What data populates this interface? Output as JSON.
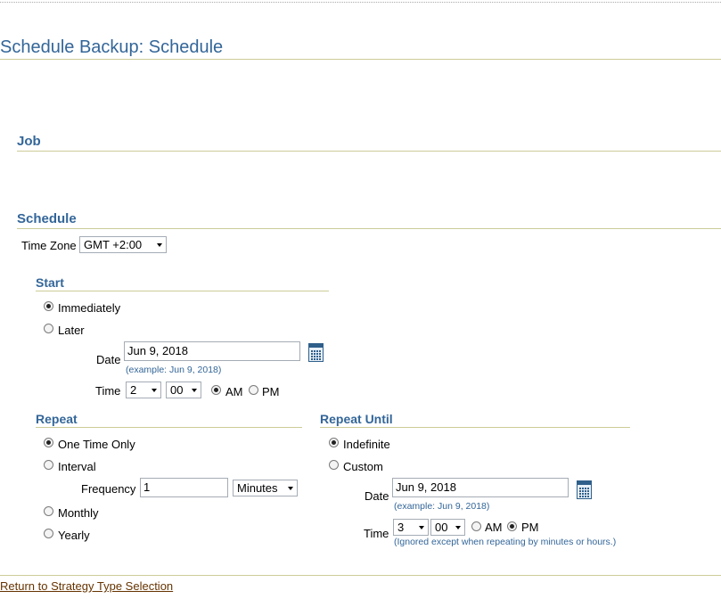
{
  "page": {
    "title": "Schedule Backup: Schedule"
  },
  "sections": {
    "job": "Job",
    "schedule": "Schedule"
  },
  "timezone": {
    "label": "Time Zone",
    "value": "GMT +2:00"
  },
  "start": {
    "heading": "Start",
    "immediately": "Immediately",
    "later": "Later",
    "date_label": "Date",
    "date_value": "Jun 9, 2018",
    "date_example": "(example: Jun 9, 2018)",
    "time_label": "Time",
    "hour": "2",
    "minute": "00",
    "am": "AM",
    "pm": "PM"
  },
  "repeat": {
    "heading": "Repeat",
    "one_time": "One Time Only",
    "interval": "Interval",
    "frequency_label": "Frequency",
    "frequency_value": "1",
    "frequency_unit": "Minutes",
    "monthly": "Monthly",
    "yearly": "Yearly"
  },
  "repeat_until": {
    "heading": "Repeat Until",
    "indefinite": "Indefinite",
    "custom": "Custom",
    "date_label": "Date",
    "date_value": "Jun 9, 2018",
    "date_example": "(example: Jun 9, 2018)",
    "time_label": "Time",
    "hour": "3",
    "minute": "00",
    "am": "AM",
    "pm": "PM",
    "time_note": "(Ignored except when repeating by minutes or hours.)"
  },
  "footer": {
    "return_link": "Return to Strategy Type Selection"
  },
  "icons": {
    "calendar": "calendar-icon",
    "dropdown": "chevron-down-icon"
  },
  "colors": {
    "heading": "#336699",
    "rule": "#cccc99",
    "link": "#663300"
  }
}
